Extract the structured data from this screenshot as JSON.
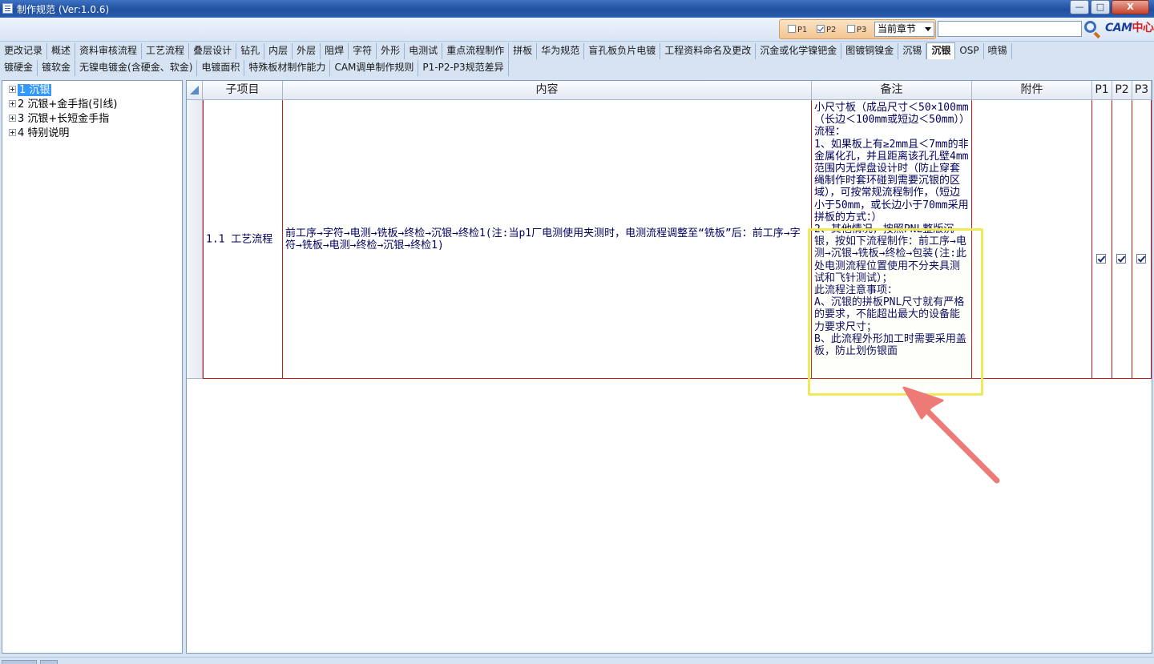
{
  "window": {
    "title": "制作规范 (Ver:1.0.6)",
    "minimize": "—",
    "maximize": "□",
    "close": "X"
  },
  "toolbar": {
    "filters": [
      {
        "label": "P1",
        "checked": false
      },
      {
        "label": "P2",
        "checked": true
      },
      {
        "label": "P3",
        "checked": false
      }
    ],
    "scope_select": "当前章节",
    "search_value": "",
    "logo_text": "CAM",
    "logo_cn": "中心"
  },
  "tabs": {
    "row1": [
      "更改记录",
      "概述",
      "资料审核流程",
      "工艺流程",
      "叠层设计",
      "钻孔",
      "内层",
      "外层",
      "阻焊",
      "字符",
      "外形",
      "电测试",
      "重点流程制作",
      "拼板",
      "华为规范",
      "盲孔板负片电镀",
      "工程资料命名及更改",
      "沉金或化学镍钯金",
      "图镀铜镍金",
      "沉锡",
      "沉银",
      "OSP",
      "喷锡"
    ],
    "row2": [
      "镀硬金",
      "镀软金",
      "无镍电镀金(含硬金、软金)",
      "电镀面积",
      "特殊板材制作能力",
      "CAM调单制作规则",
      "P1-P2-P3规范差异"
    ],
    "active": "沉银"
  },
  "tree": [
    {
      "label": "1 沉银",
      "selected": true
    },
    {
      "label": "2 沉银+金手指(引线)",
      "selected": false
    },
    {
      "label": "3 沉银+长短金手指",
      "selected": false
    },
    {
      "label": "4 特别说明",
      "selected": false
    }
  ],
  "grid": {
    "columns": [
      "子项目",
      "内容",
      "备注",
      "附件",
      "P1",
      "P2",
      "P3"
    ],
    "rows": [
      {
        "subitem": "1.1 工艺流程",
        "content": "前工序→字符→电测→铣板→终检→沉银→终检1(注:当p1厂电测使用夹测时，电测流程调整至“铣板”后：前工序→字符→铣板→电测→终检→沉银→终检1)",
        "note": "小尺寸板（成品尺寸＜50×100mm（长边＜100mm或短边＜50mm））流程：\n1、如果板上有≥2mm且＜7mm的非金属化孔，并且距离该孔孔壁4mm范围内无焊盘设计时（防止穿套绳制作时套环碰到需要沉银的区域），可按常规流程制作，（短边小于50mm，或长边小于70mm采用拼板的方式：）\n2、其他情况，按照PNL整版沉银，按如下流程制作：前工序→电测→沉银→铣板→终检→包装(注:此处电测流程位置使用不分夹具测试和飞针测试）；\n此流程注意事项：\nA、沉银的拼板PNL尺寸就有严格的要求，不能超出最大的设备能力要求尺寸；\nB、此流程外形加工时需要采用盖板，防止划伤银面",
        "attachment": "",
        "p1": true,
        "p2": true,
        "p3": true
      }
    ]
  },
  "colors": {
    "highlight": "#f0ea5a",
    "arrow": "#ee7a78",
    "grid_border": "#c41a1a",
    "text": "#00005e"
  }
}
